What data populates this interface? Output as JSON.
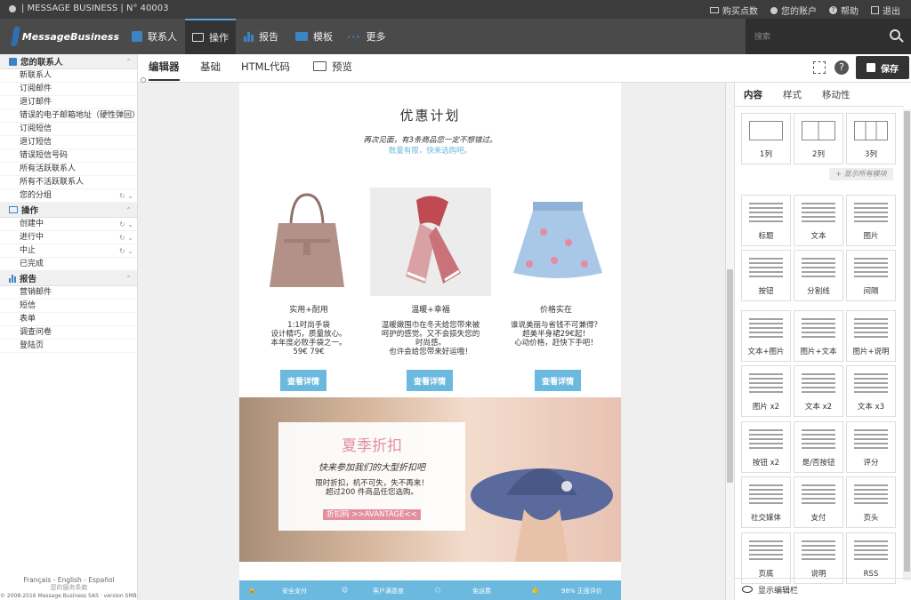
{
  "topbar": {
    "account_label": "|  MESSAGE BUSINESS  |  N° 40003",
    "buy_credits": "购买点数",
    "my_account": "您的账户",
    "help": "帮助",
    "logout": "退出"
  },
  "nav": {
    "logo_text": "MessageBusiness",
    "items": [
      {
        "label": "联系人"
      },
      {
        "label": "操作"
      },
      {
        "label": "报告"
      },
      {
        "label": "模板"
      },
      {
        "label": "更多"
      }
    ],
    "search_placeholder": "搜索"
  },
  "sidebar": {
    "contacts_title": "您的联系人",
    "contacts": [
      "新联系人",
      "订阅邮件",
      "退订邮件",
      "错误的电子邮箱地址（硬性弹回）",
      "订阅短信",
      "退订短信",
      "错误短信号码",
      "所有活跃联系人",
      "所有不活跃联系人",
      "您的分组"
    ],
    "operations_title": "操作",
    "operations": [
      "创建中",
      "进行中",
      "中止",
      "已完成"
    ],
    "reports_title": "报告",
    "reports": [
      "营销邮件",
      "短信",
      "表单",
      "调查问卷",
      "登陆页"
    ],
    "languages": "Français - English - Español",
    "terms": "您的服务条款",
    "copyright": "© 2008-2016 Message Business SAS · version SMB 1601-01-01"
  },
  "toolbar": {
    "tab_editor": "编辑器",
    "tab_basic": "基础",
    "tab_html": "HTML代码",
    "tab_preview": "预览",
    "save": "保存"
  },
  "email": {
    "title": "优惠计划",
    "subtitle": "再次见面，有3条商品您一定不想错过。",
    "subtitle2": "数量有限，快来选购吧。",
    "products": [
      {
        "title": "实用+耐用",
        "desc": "1:1时尚手袋\n设计精巧，质量放心。\n本年度必败手袋之一。\n59€   79€",
        "button": "查看详情",
        "image": "handbag"
      },
      {
        "title": "温暖+幸福",
        "desc": "温暖嫩围巾在冬天给您带来被\n呵护的感觉。又不会损失您的\n时尚感。\n也许会给您带来好运哦！",
        "button": "查看详情",
        "image": "scarf"
      },
      {
        "title": "价格实在",
        "desc": "谁说美丽与省钱不可兼得？\n超美半身裙29€起！\n心动价格，赶快下手吧！",
        "button": "查看详情",
        "image": "skirt"
      }
    ],
    "banner": {
      "title": "夏季折扣",
      "subtitle": "快来参加我们的大型折扣吧",
      "body": "限时折扣，机不可失，失不再来！\n超过200 件商品任您选购。",
      "code": "折扣码 >>AVANTAGE<<"
    },
    "footer": [
      "安全支付",
      "客户满意度",
      "免运费",
      "98% 正面评价"
    ]
  },
  "right_panel": {
    "tabs": [
      "内容",
      "样式",
      "移动性"
    ],
    "show_all": "+ 显示所有模块",
    "layouts": [
      "1列",
      "2列",
      "3列"
    ],
    "blocks": [
      "标题",
      "文本",
      "图片",
      "按钮",
      "分割线",
      "间隔",
      "文本+图片",
      "图片+文本",
      "图片+说明",
      "图片 x2",
      "文本 x2",
      "文本 x3",
      "按钮 x2",
      "是/否按钮",
      "评分",
      "社交媒体",
      "支付",
      "页头",
      "页底",
      "说明",
      "RSS"
    ],
    "show_editor": "显示编辑栏"
  },
  "colors": {
    "topbar": "#3c3c3c",
    "nav": "#4a4a4a",
    "accent": "#6bb9df",
    "nav_icon": "#3d84c6"
  }
}
